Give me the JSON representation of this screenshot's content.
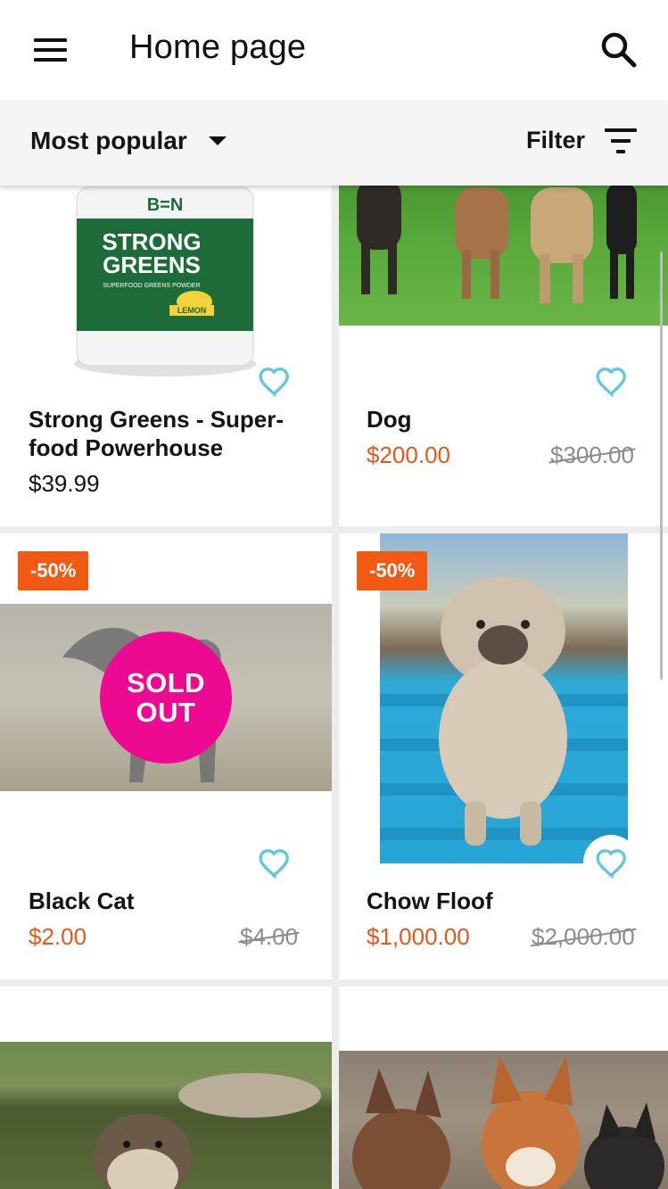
{
  "app_bar": {
    "title": "Home page",
    "menu_icon": "hamburger-menu-icon",
    "search_icon": "search-icon"
  },
  "sort_bar": {
    "sort_label": "Most popular",
    "filter_label": "Filter"
  },
  "colors": {
    "accent_price": "#e6571b",
    "badge": "#f05a13",
    "sold_out": "#ec0a92",
    "heart": "#5fc8dc"
  },
  "products": [
    {
      "name": "Strong Greens - Super-food Powerhouse",
      "price": "$39.99",
      "image": "strong-greens-jar",
      "jar": {
        "brand": "B=N",
        "line1": "STRONG",
        "line2": "GREENS",
        "sub": "SUPERFOOD GREENS POWDER",
        "flavor": "LEMON"
      }
    },
    {
      "name": "Dog",
      "price": "$200.00",
      "old_price": "$300.00",
      "image": "dogs-on-grass"
    },
    {
      "name": "Black Cat",
      "price": "$2.00",
      "old_price": "$4.00",
      "badge": "-50%",
      "sold_out": "SOLD OUT",
      "image": "black-cat-walking"
    },
    {
      "name": "Chow Floof",
      "price": "$1,000.00",
      "old_price": "$2,000.00",
      "badge": "-50%",
      "image": "chow-puppy-on-bench"
    },
    {
      "image": "otter-in-water"
    },
    {
      "image": "fox-cubs"
    }
  ]
}
